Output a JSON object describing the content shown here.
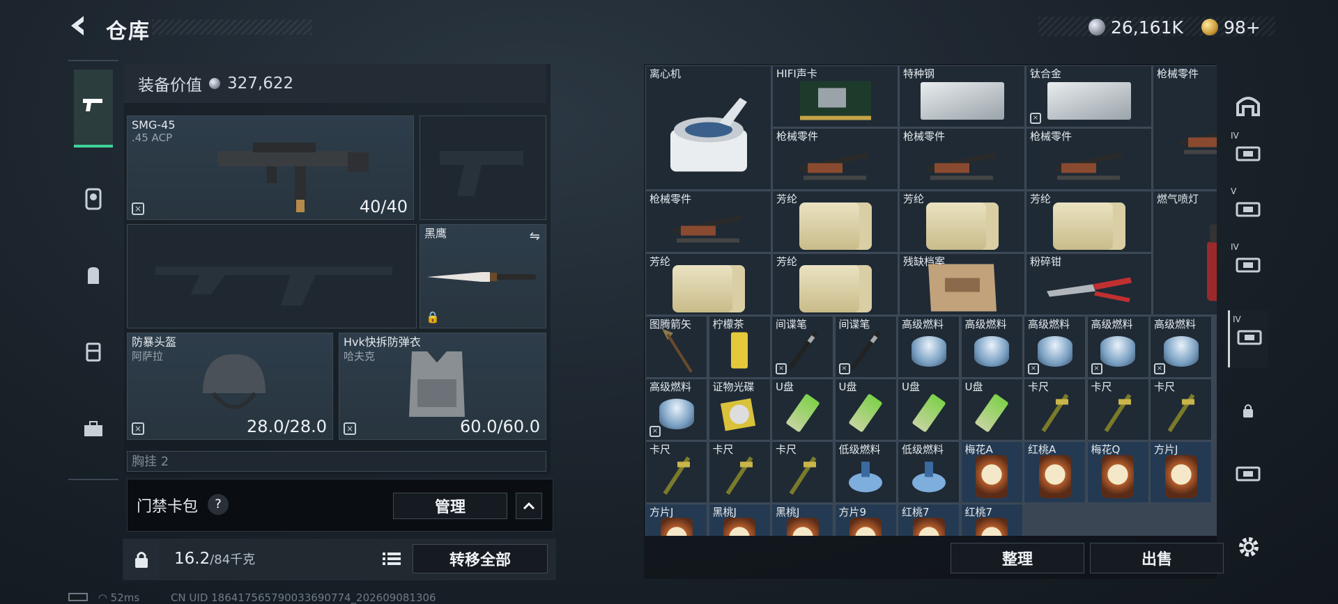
{
  "header": {
    "back_icon": "chevron-left-icon",
    "title": "仓库",
    "currency_silver": "26,161K",
    "currency_gold": "98+",
    "colors": {
      "accent": "#3fd39a",
      "panel": "#232c34",
      "grid_cell": "#1f2a35"
    }
  },
  "left_tabs": [
    {
      "icon": "pistol-icon",
      "active": true
    },
    {
      "icon": "character-icon",
      "active": false
    },
    {
      "icon": "backpack-icon",
      "active": false
    },
    {
      "icon": "chest-rig-icon",
      "active": false
    },
    {
      "icon": "toolbox-icon",
      "active": false
    }
  ],
  "equipment": {
    "value_label": "装备价值",
    "value": "327,622",
    "primary_name": "SMG-45",
    "primary_ammo": ".45 ACP",
    "primary_count": "40/40",
    "melee_name": "黑鹰",
    "helmet_name": "防暴头盔",
    "helmet_sub": "阿萨拉",
    "helmet_dura": "28.0/28.0",
    "armor_name": "Hvk快拆防弹衣",
    "armor_sub": "哈夫克",
    "armor_dura": "60.0/60.0",
    "next_slot": "胸挂",
    "next_slot_count": "2"
  },
  "card_pack": {
    "label": "门禁卡包",
    "help": "?",
    "manage": "管理"
  },
  "bottom": {
    "weight": "16.2",
    "weight_max": "/84千克",
    "transfer_all": "转移全部",
    "sort": "整理",
    "sell": "出售"
  },
  "status": {
    "ping": "52ms",
    "uid": "CN UID 1864175657900336907​74_202609081306"
  },
  "storage_items": [
    {
      "name": "离心机",
      "col": 0,
      "row": 0,
      "w": 1,
      "h": 2,
      "pic": "centrifuge",
      "noins": false
    },
    {
      "name": "HIFI声卡",
      "col": 1,
      "row": 0,
      "w": 1,
      "h": 1,
      "pic": "card",
      "noins": false
    },
    {
      "name": "特种钢",
      "col": 2,
      "row": 0,
      "w": 1,
      "h": 1,
      "pic": "metal",
      "noins": false
    },
    {
      "name": "钛合金",
      "col": 3,
      "row": 0,
      "w": 1,
      "h": 1,
      "pic": "metal",
      "noins": true
    },
    {
      "name": "枪械零件",
      "col": 4,
      "row": 0,
      "w": 1,
      "h": 2,
      "pic": "parts",
      "noins": false
    },
    {
      "name": "枪械零件",
      "col": 1,
      "row": 1,
      "w": 1,
      "h": 1,
      "pic": "parts",
      "noins": false
    },
    {
      "name": "枪械零件",
      "col": 2,
      "row": 1,
      "w": 1,
      "h": 1,
      "pic": "parts",
      "noins": false
    },
    {
      "name": "枪械零件",
      "col": 3,
      "row": 1,
      "w": 1,
      "h": 1,
      "pic": "parts",
      "noins": false
    },
    {
      "name": "枪械零件",
      "col": 0,
      "row": 2,
      "w": 1,
      "h": 1,
      "pic": "parts",
      "noins": false
    },
    {
      "name": "芳纶",
      "col": 1,
      "row": 2,
      "w": 1,
      "h": 1,
      "pic": "roll",
      "noins": false
    },
    {
      "name": "芳纶",
      "col": 2,
      "row": 2,
      "w": 1,
      "h": 1,
      "pic": "roll",
      "noins": false
    },
    {
      "name": "芳纶",
      "col": 3,
      "row": 2,
      "w": 1,
      "h": 1,
      "pic": "roll",
      "noins": false
    },
    {
      "name": "燃气喷灯",
      "col": 4,
      "row": 2,
      "w": 1,
      "h": 2,
      "pic": "torch",
      "noins": false
    },
    {
      "name": "芳纶",
      "col": 0,
      "row": 3,
      "w": 1,
      "h": 1,
      "pic": "roll",
      "noins": false
    },
    {
      "name": "芳纶",
      "col": 1,
      "row": 3,
      "w": 1,
      "h": 1,
      "pic": "roll",
      "noins": false
    },
    {
      "name": "残缺档案",
      "col": 2,
      "row": 3,
      "w": 1,
      "h": 1,
      "pic": "doc",
      "noins": false
    },
    {
      "name": "粉碎钳",
      "col": 3,
      "row": 3,
      "w": 1,
      "h": 1,
      "pic": "plier",
      "noins": false
    }
  ],
  "storage_small": [
    {
      "name": "图腾箭矢",
      "noins": false,
      "pic": "arrow"
    },
    {
      "name": "柠檬茶",
      "noins": false,
      "pic": "drink"
    },
    {
      "name": "间谍笔",
      "noins": true,
      "pic": "pen"
    },
    {
      "name": "间谍笔",
      "noins": true,
      "pic": "pen"
    },
    {
      "name": "高级燃料",
      "noins": false,
      "pic": "can"
    },
    {
      "name": "高级燃料",
      "noins": false,
      "pic": "can"
    },
    {
      "name": "高级燃料",
      "noins": true,
      "pic": "can"
    },
    {
      "name": "高级燃料",
      "noins": true,
      "pic": "can"
    },
    {
      "name": "高级燃料",
      "noins": true,
      "pic": "can"
    },
    {
      "name": "高级燃料",
      "noins": true,
      "pic": "can"
    },
    {
      "name": "证物光碟",
      "noins": false,
      "pic": "disc"
    },
    {
      "name": "U盘",
      "noins": false,
      "pic": "usb"
    },
    {
      "name": "U盘",
      "noins": false,
      "pic": "usb"
    },
    {
      "name": "U盘",
      "noins": false,
      "pic": "usb"
    },
    {
      "name": "U盘",
      "noins": false,
      "pic": "usb"
    },
    {
      "name": "卡尺",
      "noins": false,
      "pic": "caliper"
    },
    {
      "name": "卡尺",
      "noins": false,
      "pic": "caliper"
    },
    {
      "name": "卡尺",
      "noins": false,
      "pic": "caliper"
    },
    {
      "name": "卡尺",
      "noins": false,
      "pic": "caliper"
    },
    {
      "name": "卡尺",
      "noins": false,
      "pic": "caliper"
    },
    {
      "name": "卡尺",
      "noins": false,
      "pic": "caliper"
    },
    {
      "name": "低级燃料",
      "noins": false,
      "pic": "fuel"
    },
    {
      "name": "低级燃料",
      "noins": false,
      "pic": "fuel"
    },
    {
      "name": "梅花A",
      "noins": false,
      "pic": "cardtok",
      "accent": true
    },
    {
      "name": "红桃A",
      "noins": false,
      "pic": "cardtok",
      "accent": true
    },
    {
      "name": "梅花Q",
      "noins": false,
      "pic": "cardtok",
      "accent": true
    },
    {
      "name": "方片J",
      "noins": false,
      "pic": "cardtok",
      "accent": true
    },
    {
      "name": "方片J",
      "noins": false,
      "pic": "cardtok",
      "accent": true
    },
    {
      "name": "黑桃J",
      "noins": false,
      "pic": "cardtok",
      "accent": true
    },
    {
      "name": "黑桃J",
      "noins": false,
      "pic": "cardtok",
      "accent": true
    },
    {
      "name": "方片9",
      "noins": false,
      "pic": "cardtok",
      "accent": true
    },
    {
      "name": "红桃7",
      "noins": false,
      "pic": "cardtok",
      "accent": true
    },
    {
      "name": "红桃7",
      "noins": false,
      "pic": "cardtok",
      "accent": true
    }
  ],
  "right_tabs": [
    {
      "icon": "storage-arch-icon",
      "lv": ""
    },
    {
      "icon": "add-storage-icon",
      "lv": "IV"
    },
    {
      "icon": "storage-expansion-icon",
      "lv": "V"
    },
    {
      "icon": "storage-expansion-icon",
      "lv": "IV"
    },
    {
      "icon": "storage-expansion-icon",
      "lv": "IV",
      "active": true
    },
    {
      "icon": "lock-icon",
      "lv": ""
    },
    {
      "icon": "storage-locked-icon",
      "lv": ""
    }
  ]
}
